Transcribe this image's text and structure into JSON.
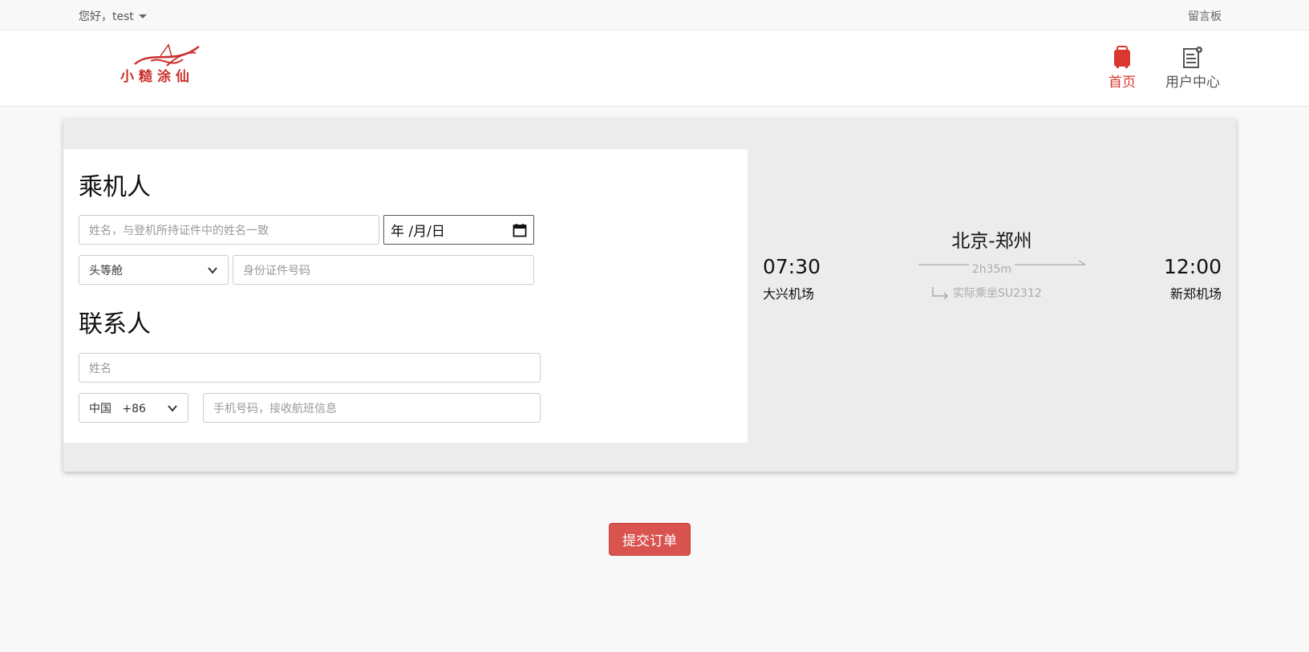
{
  "topbar": {
    "greeting": "您好，test",
    "board_link": "留言板"
  },
  "header": {
    "logo_text": "小糙涂仙",
    "nav": [
      {
        "label": "首页",
        "icon": "suitcase-icon",
        "active": true
      },
      {
        "label": "用户中心",
        "icon": "user-center-icon",
        "active": false
      }
    ]
  },
  "passenger": {
    "title": "乘机人",
    "name_placeholder": "姓名，与登机所持证件中的姓名一致",
    "date_value": "年 /月/日",
    "cabin": "头等舱",
    "id_placeholder": "身份证件号码"
  },
  "contact": {
    "title": "联系人",
    "name_placeholder": "姓名",
    "country_code": "中国   +86",
    "phone_placeholder": "手机号码，接收航班信息"
  },
  "flight": {
    "route": "北京-郑州",
    "dep_time": "07:30",
    "dep_airport": "大兴机场",
    "arr_time": "12:00",
    "arr_airport": "新郑机场",
    "duration": "2h35m",
    "operated_by": "实际乘坐SU2312"
  },
  "submit_label": "提交订单",
  "colors": {
    "accent": "#d9534f",
    "nav_active": "#d9372f",
    "card_bg": "#ececec"
  }
}
